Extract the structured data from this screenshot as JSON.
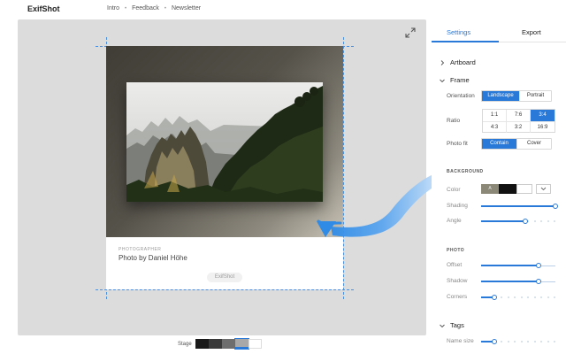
{
  "app": {
    "title": "ExifShot"
  },
  "nav": {
    "items": [
      "Intro",
      "Feedback",
      "Newsletter"
    ],
    "separator": "•"
  },
  "canvas": {
    "photographer_label": "PHOTOGRAPHER",
    "credit": "Photo by Daniel Höhe",
    "watermark": "ExifShot"
  },
  "stage": {
    "label": "Stage",
    "swatches": [
      "#1a1a1a",
      "#3a3a3a",
      "#6e6e6e",
      "#a8a8a8",
      "#ffffff"
    ],
    "selected_index": 3
  },
  "panel": {
    "tabs": [
      {
        "label": "Settings",
        "active": true
      },
      {
        "label": "Export",
        "active": false
      }
    ],
    "sections": {
      "artboard": {
        "title": "Artboard",
        "expanded": false
      },
      "frame": {
        "title": "Frame",
        "expanded": true
      },
      "tags": {
        "title": "Tags",
        "expanded": true
      }
    },
    "orientation": {
      "label": "Orientation",
      "options": [
        "Landscape",
        "Portrait"
      ],
      "selected": "Landscape"
    },
    "ratio": {
      "label": "Ratio",
      "options": [
        "1:1",
        "7:6",
        "3:4",
        "4:3",
        "3:2",
        "16:9"
      ],
      "selected": "3:4"
    },
    "photo_fit": {
      "label": "Photo fit",
      "options": [
        "Contain",
        "Cover"
      ],
      "selected": "Contain"
    },
    "background": {
      "heading": "BACKGROUND",
      "color_label": "Color",
      "color_swatches": [
        "#8b8878",
        "#111111",
        "#ffffff"
      ],
      "color_swatch_letter": "A",
      "shading_label": "Shading",
      "shading_value": 1.0,
      "angle_label": "Angle",
      "angle_value": 0.6
    },
    "photo": {
      "heading": "PHOTO",
      "offset_label": "Offset",
      "offset_value": 0.77,
      "shadow_label": "Shadow",
      "shadow_value": 0.77,
      "corners_label": "Corners",
      "corners_value": 0.18
    },
    "tags": {
      "name_size_label": "Name size",
      "name_size_value": 0.18
    }
  },
  "colors": {
    "accent": "#2979d8",
    "canvas": "#dcdcdc",
    "arrow": "#2f8be6"
  }
}
